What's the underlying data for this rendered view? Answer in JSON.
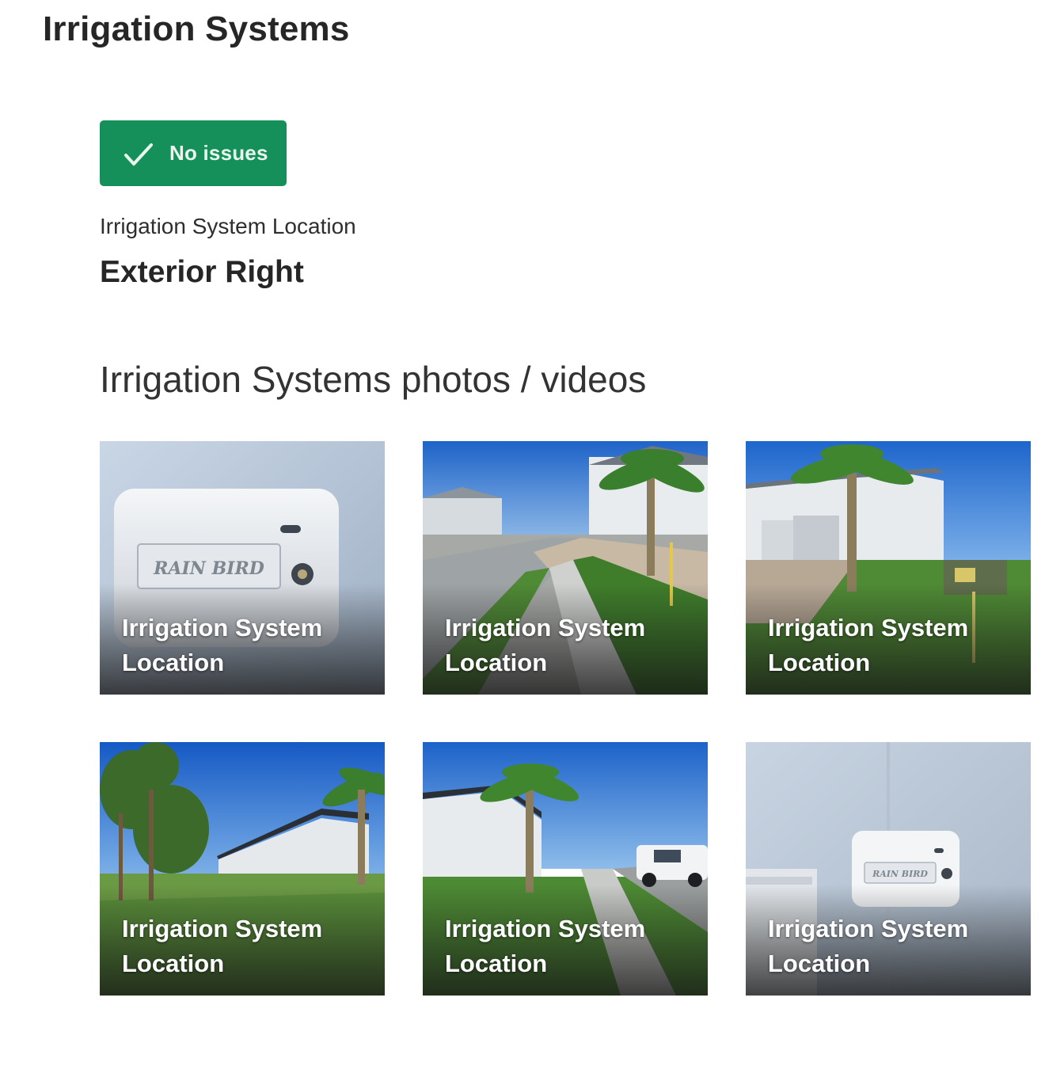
{
  "section": {
    "title": "Irrigation Systems"
  },
  "status": {
    "label": "No issues",
    "icon": "checkmark-icon",
    "color": "#15905a"
  },
  "field": {
    "label": "Irrigation System Location",
    "value": "Exterior Right"
  },
  "media": {
    "heading": "Irrigation Systems photos / videos",
    "items": [
      {
        "caption": "Irrigation System Location",
        "brand_text": "RAIN BIRD"
      },
      {
        "caption": "Irrigation System Location"
      },
      {
        "caption": "Irrigation System Location"
      },
      {
        "caption": "Irrigation System Location"
      },
      {
        "caption": "Irrigation System Location"
      },
      {
        "caption": "Irrigation System Location",
        "brand_text": "RAIN BIRD"
      }
    ]
  }
}
